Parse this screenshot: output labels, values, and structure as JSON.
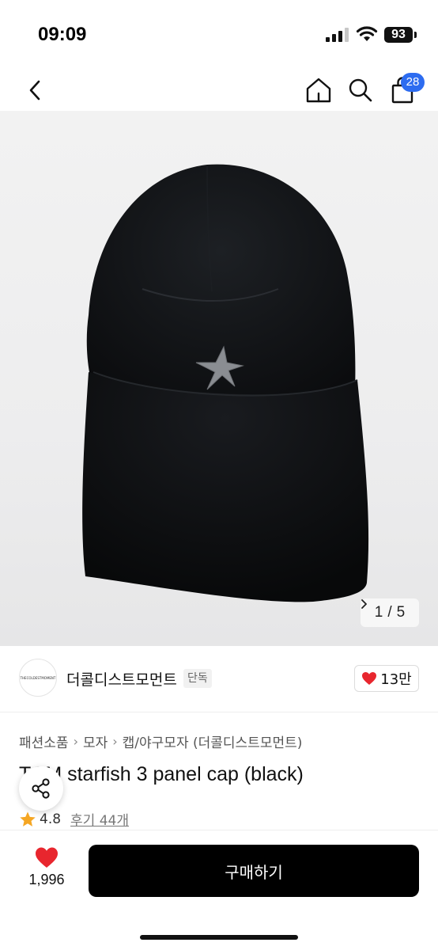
{
  "status_bar": {
    "time": "09:09",
    "battery": "93",
    "icons": [
      "signal-icon",
      "wifi-icon",
      "battery-icon"
    ]
  },
  "nav": {
    "icons": [
      "back-icon",
      "home-icon",
      "search-icon",
      "shopping-bag-icon"
    ],
    "cart_count": "28"
  },
  "gallery": {
    "current": "1",
    "separator": "/",
    "total": "5",
    "next_icon": "chevron-right-icon"
  },
  "brand": {
    "logo_text": "THECOLDESTMOMENT",
    "name": "더콜디스트모먼트",
    "tag": "단독",
    "like_count": "13만",
    "like_icon": "heart-icon"
  },
  "breadcrumb": [
    "패션소품",
    "모자",
    "캡/야구모자 (더콜디스트모먼트)"
  ],
  "product": {
    "title": "TCM starfish 3 panel cap (black)",
    "rating": "4.8",
    "review_label": "후기 44개",
    "star_color": "#f5a623"
  },
  "bottom_bar": {
    "wish_count": "1,996",
    "buy_label": "구매하기",
    "heart_color": "#e8262e"
  },
  "colors": {
    "accent_badge": "#2d6cf0",
    "primary_button": "#000000"
  }
}
